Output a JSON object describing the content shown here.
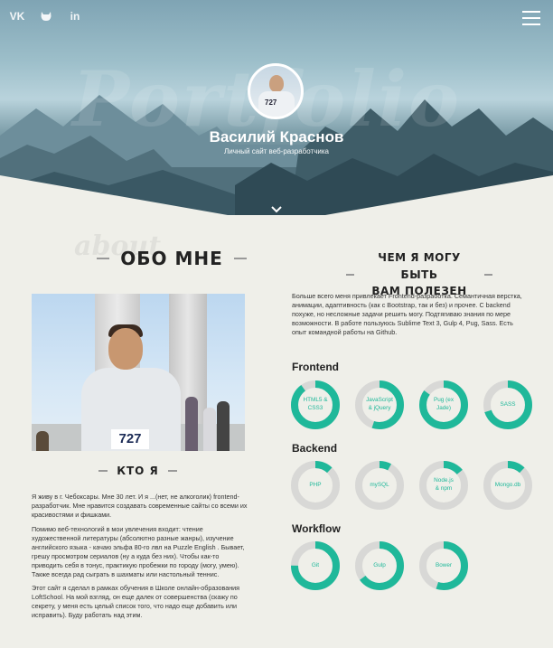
{
  "hero": {
    "bg_word": "Portfolio",
    "name": "Василий Краснов",
    "subtitle": "Личный сайт веб-разработчика",
    "avatar_number": "727",
    "socials": [
      {
        "label": "VK",
        "icon": "vk-icon"
      },
      {
        "label": "■",
        "icon": "github-icon"
      },
      {
        "label": "in",
        "icon": "linkedin-icon"
      }
    ],
    "scroll_glyph": "⌄"
  },
  "about": {
    "bg_word": "about",
    "title": "ОБО МНЕ",
    "photo_number": "727",
    "who_title": "КТО Я",
    "paragraphs": [
      "Я живу в г. Чебоксары. Мне 30 лет. И я ...(нет, не алкоголик) frontend-разработчик. Мне нравится создавать современные сайты со всеми их красивостями и фишками.",
      "Помимо веб-технологий в мои увлечения входит: чтение художественной литературы (абсолютно разные жанры), изучение английского языка - качаю эльфа 80-го лвл на Puzzle English . Бывает, грешу просмотром сериалов (ну а куда без них). Чтобы как-то приводить себя в тонус, практикую пробежки по городу (могу, умею). Также всегда рад сыграть в шахматы или настольный теннис.",
      "Этот сайт я сделал в рамках обучения в Школе онлайн-образования LoftSchool. На мой взгляд, он еще далек от совершенства (скажу по секрету, у меня есть целый список того, что надо еще добавить или исправить). Буду работать над этим."
    ]
  },
  "useful": {
    "title_line1": "ЧЕМ Я МОГУ БЫТЬ",
    "title_line2": "ВАМ ПОЛЕЗЕН",
    "text": "Больше всего меня привлекает Frontend-разработка. Семантичная верстка, анимации, адаптивность (как с Bootstrap, так и без) и прочее. С backend похуже, но несложные задачи решить могу. Подтягиваю знания по мере возможности. В работе пользуюсь Sublime Text 3, Gulp 4, Pug, Sass. Есть опыт командной работы на Github."
  },
  "skills": {
    "accent_color": "#1fb89a",
    "track_color": "#d8d8d6",
    "groups": [
      {
        "title": "Frontend",
        "items": [
          {
            "line1": "HTML5 &",
            "line2": "CSS3",
            "level": 0.9
          },
          {
            "line1": "JavaScript",
            "line2": "& jQuery",
            "level": 0.55
          },
          {
            "line1": "Pug (ex",
            "line2": "Jade)",
            "level": 0.85
          },
          {
            "line1": "SASS",
            "line2": "",
            "level": 0.7
          }
        ]
      },
      {
        "title": "Backend",
        "items": [
          {
            "line1": "PHP",
            "line2": "",
            "level": 0.12
          },
          {
            "line1": "mySQL",
            "line2": "",
            "level": 0.08
          },
          {
            "line1": "Node.js",
            "line2": "& npm",
            "level": 0.14
          },
          {
            "line1": "Mongo.db",
            "line2": "",
            "level": 0.12
          }
        ]
      },
      {
        "title": "Workflow",
        "items": [
          {
            "line1": "Git",
            "line2": "",
            "level": 0.75
          },
          {
            "line1": "Gulp",
            "line2": "",
            "level": 0.65
          },
          {
            "line1": "Bower",
            "line2": "",
            "level": 0.55
          }
        ]
      }
    ]
  }
}
